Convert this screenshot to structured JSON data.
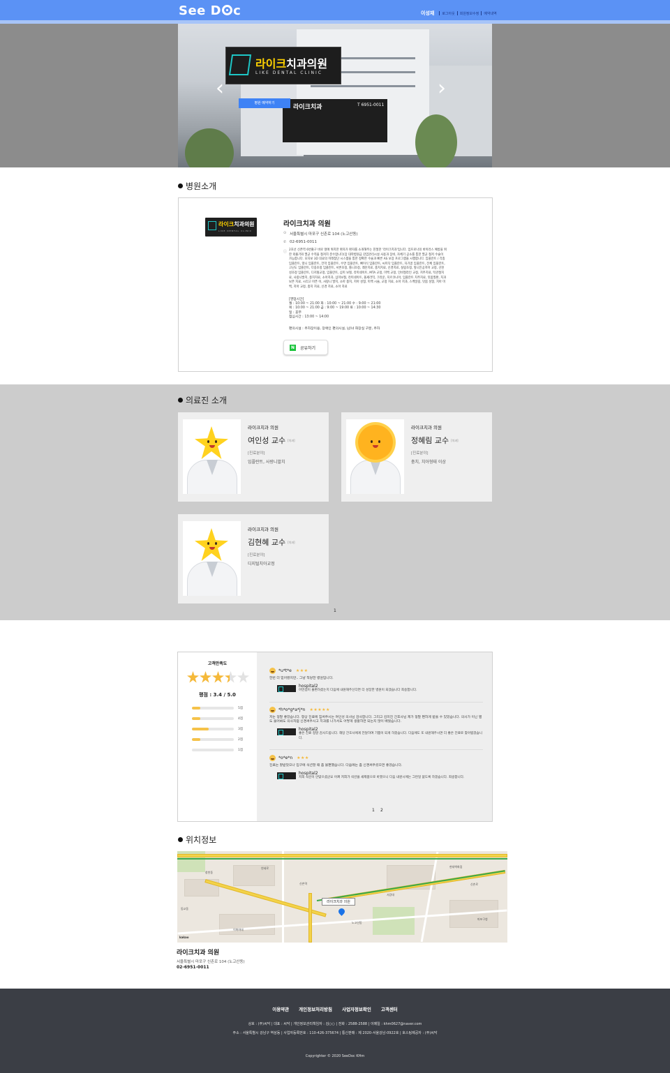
{
  "header": {
    "logo": "See Doc",
    "user": "이성재",
    "nav": [
      "로그아웃",
      "회원정보수정",
      "예약내역"
    ]
  },
  "hero": {
    "logo_title_accent": "라이크",
    "logo_title_rest": "치과의원",
    "logo_sub": "LIKE DENTAL CLINIC",
    "reserve_label": "병원 예약하기",
    "sign_text": "라이크치과",
    "phone_text": "T 6951-0011"
  },
  "sections": {
    "intro": "병원소개",
    "doctors": "의료진 소개",
    "location": "위치정보"
  },
  "hospital": {
    "logo_accent": "라이크",
    "logo_rest": "치과의원",
    "logo_sub": "LIKE DENTAL CLINIC",
    "name": "라이크치과 의원",
    "address": "서울특별시 마포구 신촌로 104 (노고산동)",
    "phone": "02-6951-0011",
    "description": "2호선 신촌역 6번출구 바로 앞에 위치한 환자가 환자를 소개해주는 친절한 '라이크치과'입니다. 임프로나의 바이러스 예방을 위한 외출기와 멸균 수칙을 철저히 준수합니다(장 대학병원급 감염관리시설 사용과 장비, 자체기 공소를 통한 멸균 철저 수술이 가능합니다. 모자보 3D 의료의 미래첨단 시스템을 통한 정확한 수술과 빠른 AS 보장 프로그램을 시행합니다. 임플란트 / 각종 임플란트, 앞니 임플란트, 전악 임플란트, 수면 임플란트, 뼈이식 임플란트, 씨미닥 임플란트, 자가골 임플란트, 전체 임플란트, 고난도 임플란트, 다용조정 임플란트, 서론조정, 틀니조정, 레진치료, 충치치료, 신경치료, 실링조정, 앞니인공치아 교정, 선천성조정 임플란트, 디지털교정, 임플란트, 심미 보철, 라미네이트, MTA 교정, 미백 교정, 인비절라인 교정, 치주치료, 턱관절치료, 사랑니발치, 충치치료, 소아치과, 심미보철, 라미네이트, 올세라믹, 크라운, 지르코니아, 임플란트 치주치료, 잇몸질환, 치과 보존 치료, 시리고 아픈 이, 사랑니 발치, 소아 충치, 치아 성형, 미백 시술, 교정 치료, 소아 치과, 스케일링, 잇몸 성형, 치아 미백, 치아 교정, 충치 치료, 신경 치료, 소아 치료",
    "hours": "[영업시간]\n월 : 10:00 ~ 21:00  화 : 10:00 ~ 21:00  수 : 9:00 ~ 21:00\n목 : 10:00 ~ 21:00  금 : 9:00 ~ 19:00  토 : 10:00 ~ 14:30\n일 : 휴무\n점심시간 : 13:00 ~ 14:00",
    "amenities": "편의시설 : 주차장이용, 장애인 편의시설, 남/녀 화장실 구분, 주차",
    "share_label": "공유하기",
    "share_icon_letter": "N"
  },
  "doctors": [
    {
      "hospital": "라이크치과 의원",
      "name": "여인성 교수",
      "position": "[치과]",
      "field_label": "[진료분야]",
      "field": "임플란트, 사랑니발치",
      "face": "star"
    },
    {
      "hospital": "라이크치과 의원",
      "name": "정혜림 교수",
      "position": "[치과]",
      "field_label": "[진료분야]",
      "field": "충치, 치아형태 이상",
      "face": "sun"
    },
    {
      "hospital": "라이크치과 의원",
      "name": "김현혜 교수",
      "position": "[치과]",
      "field_label": "[진료분야]",
      "field": "디지털치아교정",
      "face": "star"
    }
  ],
  "doctors_pager": "1",
  "reviews_summary": {
    "title": "고객만족도",
    "rating": 3.4,
    "score_text": "평점 : 3.4 / 5.0",
    "distribution": [
      {
        "label": "5점",
        "ratio": 0.2
      },
      {
        "label": "4점",
        "ratio": 0.2
      },
      {
        "label": "3점",
        "ratio": 0.4
      },
      {
        "label": "2점",
        "ratio": 0.2
      },
      {
        "label": "1점",
        "ratio": 0.0
      }
    ],
    "star_color": "#f5b93a"
  },
  "reviews": [
    {
      "author": "*u*t*e",
      "stars": "★★★",
      "text": "한번 더 믿어봤지만.. 그냥 적당한 병원입니다.",
      "reply_author": "hospital2",
      "reply_text": "어떤점이 불편하셨는지 다음에 내원해주신다면 더 성장한 병원이 되겠습니다 죄송합니다."
    },
    {
      "author": "*h*o*g*a*j*n",
      "stars": "★★★★★",
      "text": "저는 정말 좋았습니다. 항상 진료에 힘써주시는 여인성 의사님 감사합니다. 그리고 김미진 간호사님 제가 정말 편하게 받을 수 있었습니다. 의사가 이닌 별도 물어봐도 의사처럼 신경써주시고 치과를 나가서도 어떻게 생활하면 되는지 많이 배웠습니다.",
      "reply_author": "hospital2",
      "reply_text": "좋은 진료 정말 감사드립니다. 해당 간호사에게 전달하여 기쁨이 되게 하겠습니다. 다음에도 또 내원해주시면 더 좋은 진료로 찾아뵙겠습니다."
    },
    {
      "author": "*o*e*n",
      "stars": "★★★",
      "text": "진료는 잘받았으나 입구에 석션할 때 좀 불편했습니다. 다음에는 좀 신경써주셨으면 좋겠습니다.",
      "reply_author": "hospital2",
      "reply_text": "저희 석션이 안맞으셨군요 어쩌 저희가 석션을 새제품으로 바꿨으니 다음 내원시에는 그런일 없도록 하겠습니다. 죄송합니다."
    }
  ],
  "reviews_pager": [
    "1",
    "2"
  ],
  "map": {
    "tag": "라이크치과 의원",
    "kakao": "kakao",
    "labels": [
      "신촌역",
      "연세로",
      "창천동",
      "노고산동",
      "서강대",
      "현대백화점",
      "신촌로",
      "이화여대",
      "동교동",
      "마포구청"
    ]
  },
  "location": {
    "name": "라이크치과 의원",
    "address": "서울특별시 마포구 신촌로 104 (노고산동)",
    "phone": "02-6951-0011"
  },
  "footer": {
    "links": [
      "이용약관",
      "개인정보처리방침",
      "사업자정보확인",
      "고객센터"
    ],
    "info1": "상호 : (주)씨닥 | 대표 : 씨닥 | 개인정보관리책임자 : 김○○ | 전화 : 2588-2588 | 이메일 : khm0627@naver.com",
    "info2": "주소 : 서울특별시 강남구 역삼동 | 사업자등록번호 : 110-426-375674 | 통신판매 : 제 2020-서울강남-0922호 | 호스팅제공자 : (주)씨닥",
    "copyright": "Copyrighter © 2020 SeeDoc KHm"
  },
  "colors": {
    "header_blue": "#5b92f5",
    "button_blue": "#3e82f5",
    "star_yellow": "#f5b93a",
    "doctors_bg": "#cccccc",
    "footer_bg": "#3b3e45"
  }
}
